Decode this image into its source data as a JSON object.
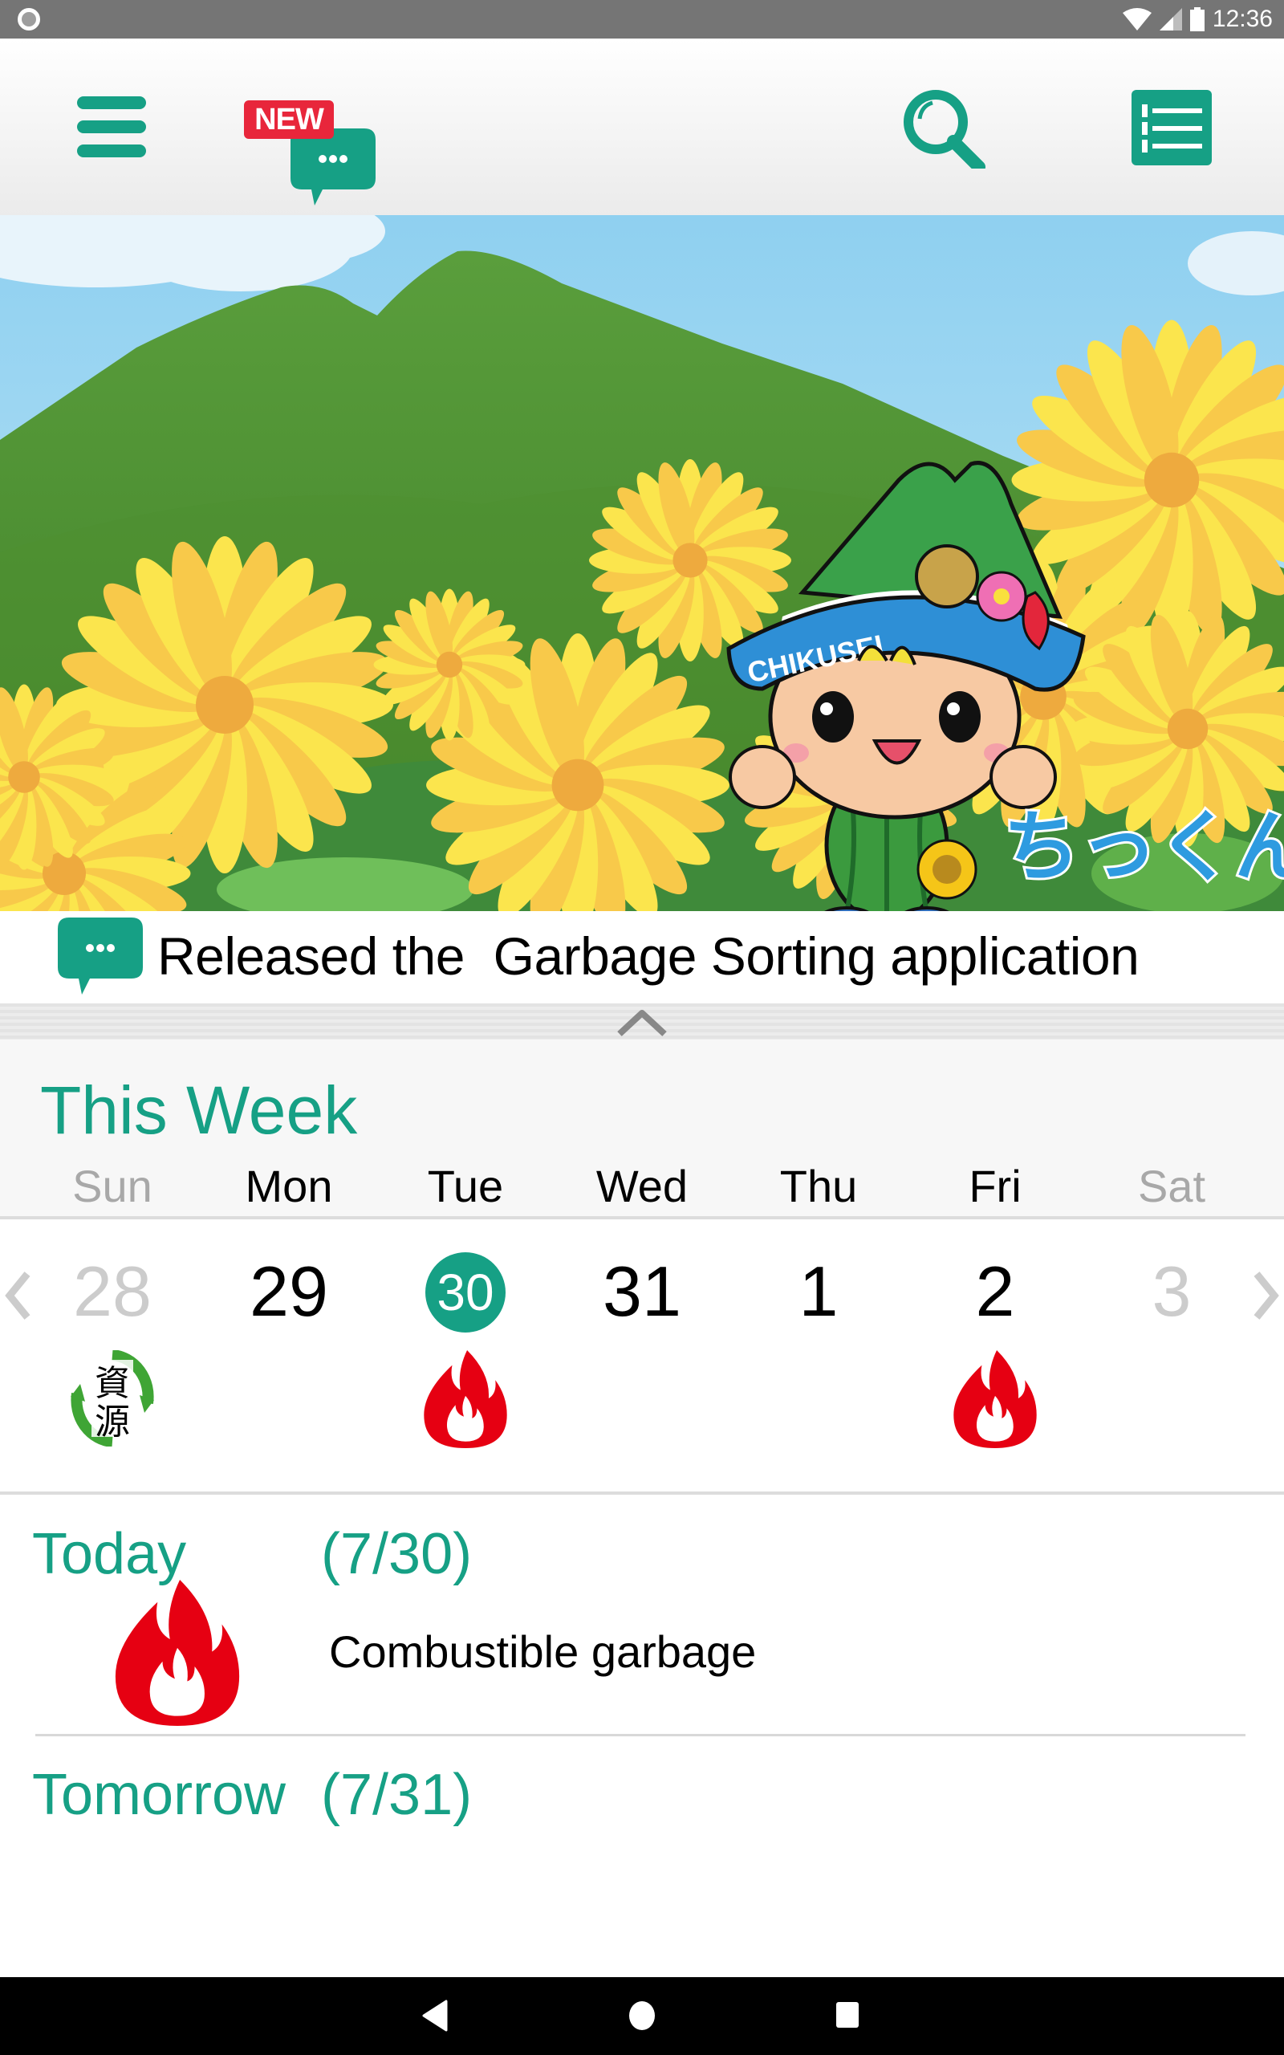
{
  "status_bar": {
    "time": "12:36",
    "icons": [
      "notification-dot-icon",
      "wifi-icon",
      "cell-signal-icon",
      "battery-icon"
    ]
  },
  "toolbar": {
    "menu_icon": "hamburger-menu-icon",
    "news_icon": "chat-bubble-icon",
    "new_badge": "NEW",
    "search_icon": "search-icon",
    "list_icon": "list-icon"
  },
  "banner": {
    "hat_text": "CHIKUSEI",
    "mascot_name": "ちっくん"
  },
  "news": {
    "icon": "chat-bubble-icon",
    "text": "Released the  Garbage Sorting application"
  },
  "collapse_icon": "chevron-up-icon",
  "week": {
    "title": "This Week",
    "prev_icon": "chevron-left-icon",
    "next_icon": "chevron-right-icon",
    "days": [
      {
        "weekday": "Sun",
        "date": "28",
        "dim": true,
        "today": false,
        "icon": "resource-recycle-icon",
        "icon_text": [
          "資",
          "源"
        ]
      },
      {
        "weekday": "Mon",
        "date": "29",
        "dim": false,
        "today": false,
        "icon": ""
      },
      {
        "weekday": "Tue",
        "date": "30",
        "dim": false,
        "today": true,
        "icon": "combustible-flame-icon"
      },
      {
        "weekday": "Wed",
        "date": "31",
        "dim": false,
        "today": false,
        "icon": ""
      },
      {
        "weekday": "Thu",
        "date": "1",
        "dim": false,
        "today": false,
        "icon": ""
      },
      {
        "weekday": "Fri",
        "date": "2",
        "dim": false,
        "today": false,
        "icon": "combustible-flame-icon"
      },
      {
        "weekday": "Sat",
        "date": "3",
        "dim": true,
        "today": false,
        "icon": ""
      }
    ]
  },
  "schedule": {
    "today": {
      "label": "Today",
      "date": "(7/30)",
      "icon": "combustible-flame-icon",
      "garbage": "Combustible garbage"
    },
    "tomorrow": {
      "label": "Tomorrow",
      "date": "(7/31)"
    }
  },
  "nav_bar": {
    "back_icon": "back-triangle-icon",
    "home_icon": "home-circle-icon",
    "recents_icon": "recents-square-icon"
  },
  "colors": {
    "accent": "#16a085",
    "flame": "#e60012",
    "new_badge": "#e8263b",
    "recycle_green": "#3fa535"
  }
}
